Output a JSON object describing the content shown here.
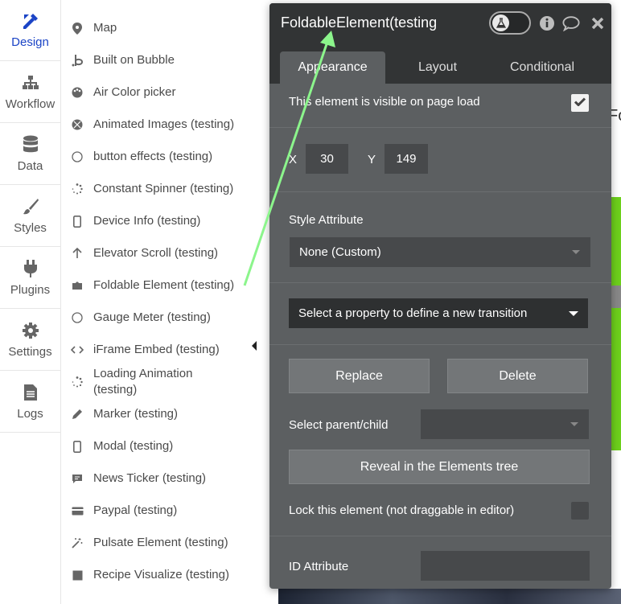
{
  "rail": {
    "items": [
      {
        "label": "Design",
        "icon": "design-icon",
        "active": true
      },
      {
        "label": "Workflow",
        "icon": "workflow-icon"
      },
      {
        "label": "Data",
        "icon": "database-icon"
      },
      {
        "label": "Styles",
        "icon": "brush-icon"
      },
      {
        "label": "Plugins",
        "icon": "plug-icon"
      },
      {
        "label": "Settings",
        "icon": "gear-icon"
      },
      {
        "label": "Logs",
        "icon": "document-icon"
      }
    ]
  },
  "elements": {
    "items": [
      {
        "label": "Map",
        "icon": "map-pin-icon"
      },
      {
        "label": "Built on Bubble",
        "icon": "bubble-logo-icon"
      },
      {
        "label": "Air Color picker",
        "icon": "palette-icon"
      },
      {
        "label": "Animated Images (testing)",
        "icon": "animated-image-icon"
      },
      {
        "label": "button effects (testing)",
        "icon": "circle-icon"
      },
      {
        "label": "Constant Spinner (testing)",
        "icon": "spinner-icon"
      },
      {
        "label": "Device Info (testing)",
        "icon": "phone-icon"
      },
      {
        "label": "Elevator Scroll (testing)",
        "icon": "arrow-up-icon"
      },
      {
        "label": "Foldable Element (testing)",
        "icon": "folder-icon"
      },
      {
        "label": "Gauge Meter (testing)",
        "icon": "circle-icon"
      },
      {
        "label": "iFrame Embed (testing)",
        "icon": "code-icon"
      },
      {
        "label": "Loading Animation",
        "label2": "(testing)",
        "icon": "spinner-icon"
      },
      {
        "label": "Marker (testing)",
        "icon": "pencil-icon"
      },
      {
        "label": "Modal (testing)",
        "icon": "phone-icon"
      },
      {
        "label": "News Ticker (testing)",
        "icon": "chat-icon"
      },
      {
        "label": "Paypal (testing)",
        "icon": "credit-card-icon"
      },
      {
        "label": "Pulsate Element (testing)",
        "icon": "magic-wand-icon"
      },
      {
        "label": "Recipe Visualize (testing)",
        "icon": "square-icon"
      }
    ]
  },
  "canvas": {
    "partial_text": "Fo"
  },
  "editor": {
    "title": "FoldableElement(testing",
    "tabs": [
      "Appearance",
      "Layout",
      "Conditional"
    ],
    "active_tab": "Appearance",
    "visible_label": "This element is visible on page load",
    "visible_checked": true,
    "x_label": "X",
    "x_value": "30",
    "y_label": "Y",
    "y_value": "149",
    "style_label": "Style Attribute",
    "style_value": "None (Custom)",
    "transition_placeholder": "Select a property to define a new transition",
    "replace_label": "Replace",
    "delete_label": "Delete",
    "parent_child_label": "Select parent/child",
    "parent_child_value": "",
    "reveal_label": "Reveal in the Elements tree",
    "lock_label": "Lock this element (not draggable in editor)",
    "lock_checked": false,
    "id_label": "ID Attribute",
    "id_value": ""
  },
  "colors": {
    "accent": "#1b44c6",
    "panel": "#5c5f61",
    "header": "#323435",
    "annotation_arrow": "#8cf58c",
    "canvas_green": "#6dd01c"
  }
}
